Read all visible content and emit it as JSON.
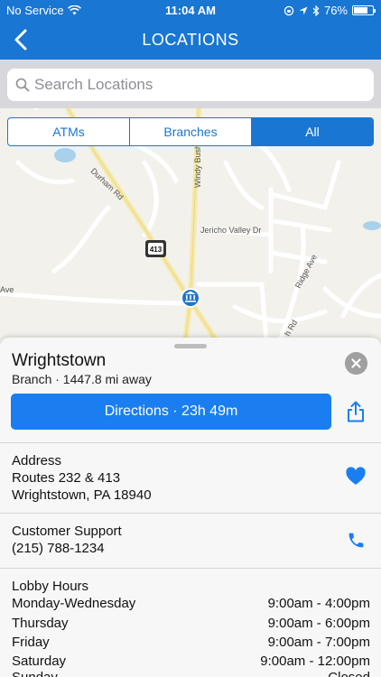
{
  "status_bar": {
    "carrier": "No Service",
    "time": "11:04 AM",
    "battery": "76%",
    "battery_level": 0.76
  },
  "nav": {
    "title": "LOCATIONS"
  },
  "search": {
    "placeholder": "Search Locations"
  },
  "filters": [
    {
      "label": "ATMs",
      "active": false
    },
    {
      "label": "Branches",
      "active": false
    },
    {
      "label": "All",
      "active": true
    }
  ],
  "map": {
    "road_labels": [
      "Durham Rd",
      "Windy Bush",
      "Jericho Valley Dr",
      "Ridge Ave",
      "Ave",
      "h Rd"
    ],
    "route_shield": "413"
  },
  "location": {
    "name": "Wrightstown",
    "subtitle": "Branch · 1447.8 mi away",
    "directions_label": "Directions · 23h 49m"
  },
  "address": {
    "title": "Address",
    "line1": "Routes 232 & 413",
    "line2": "Wrightstown, PA 18940"
  },
  "support": {
    "title": "Customer Support",
    "phone": "(215) 788-1234"
  },
  "lobby": {
    "title": "Lobby Hours",
    "rows": [
      {
        "day": "Monday-Wednesday",
        "hours": "9:00am - 4:00pm"
      },
      {
        "day": "Thursday",
        "hours": "9:00am - 6:00pm"
      },
      {
        "day": "Friday",
        "hours": "9:00am - 7:00pm"
      },
      {
        "day": "Saturday",
        "hours": "9:00am - 12:00pm"
      },
      {
        "day": "Sunday",
        "hours": "Closed"
      }
    ]
  },
  "colors": {
    "header": "#1976d2",
    "accent": "#1a7ef0",
    "map_bg": "#f2f1ec"
  }
}
